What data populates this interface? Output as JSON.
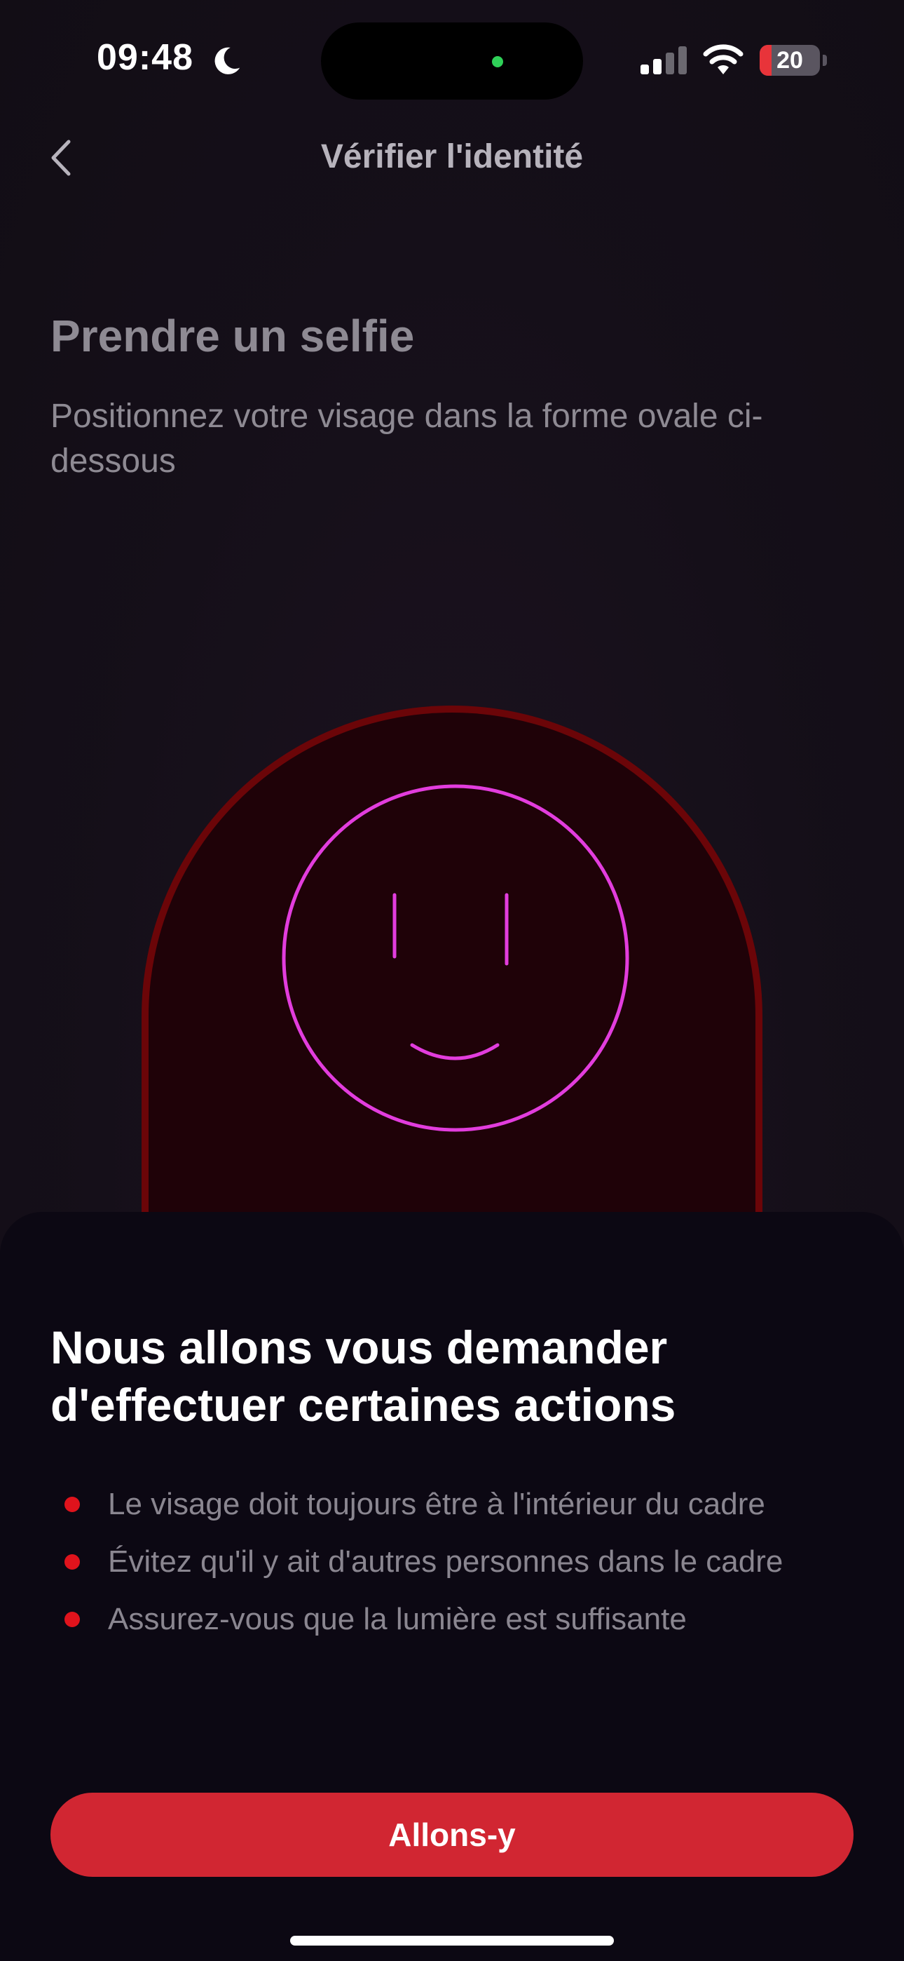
{
  "status_bar": {
    "time": "09:48",
    "battery_level": "20",
    "battery_fraction": 0.2,
    "icons": [
      "moon-icon",
      "signal-icon",
      "wifi-icon",
      "battery-icon"
    ]
  },
  "nav": {
    "back_icon": "chevron-left-icon",
    "title": "Vérifier l'identité"
  },
  "header": {
    "heading": "Prendre un selfie",
    "subtitle": "Positionnez votre visage dans la forme ovale ci-dessous"
  },
  "frame": {
    "icon": "smiley-face-icon",
    "colors": {
      "frame_border": "#6b0508",
      "face_stroke": "#e23ddd"
    }
  },
  "sheet": {
    "title": "Nous allons vous demander d'effectuer certaines actions",
    "items": [
      {
        "text": "Le visage doit toujours être à l'intérieur du cadre"
      },
      {
        "text": "Évitez qu'il y ait d'autres personnes dans le cadre"
      },
      {
        "text": "Assurez-vous que la lumière est suffisante"
      }
    ],
    "button_label": "Allons-y"
  },
  "colors": {
    "accent": "#d12632",
    "bullet": "#e0131c",
    "background": "#15101a",
    "sheet_background": "#0c0813"
  }
}
